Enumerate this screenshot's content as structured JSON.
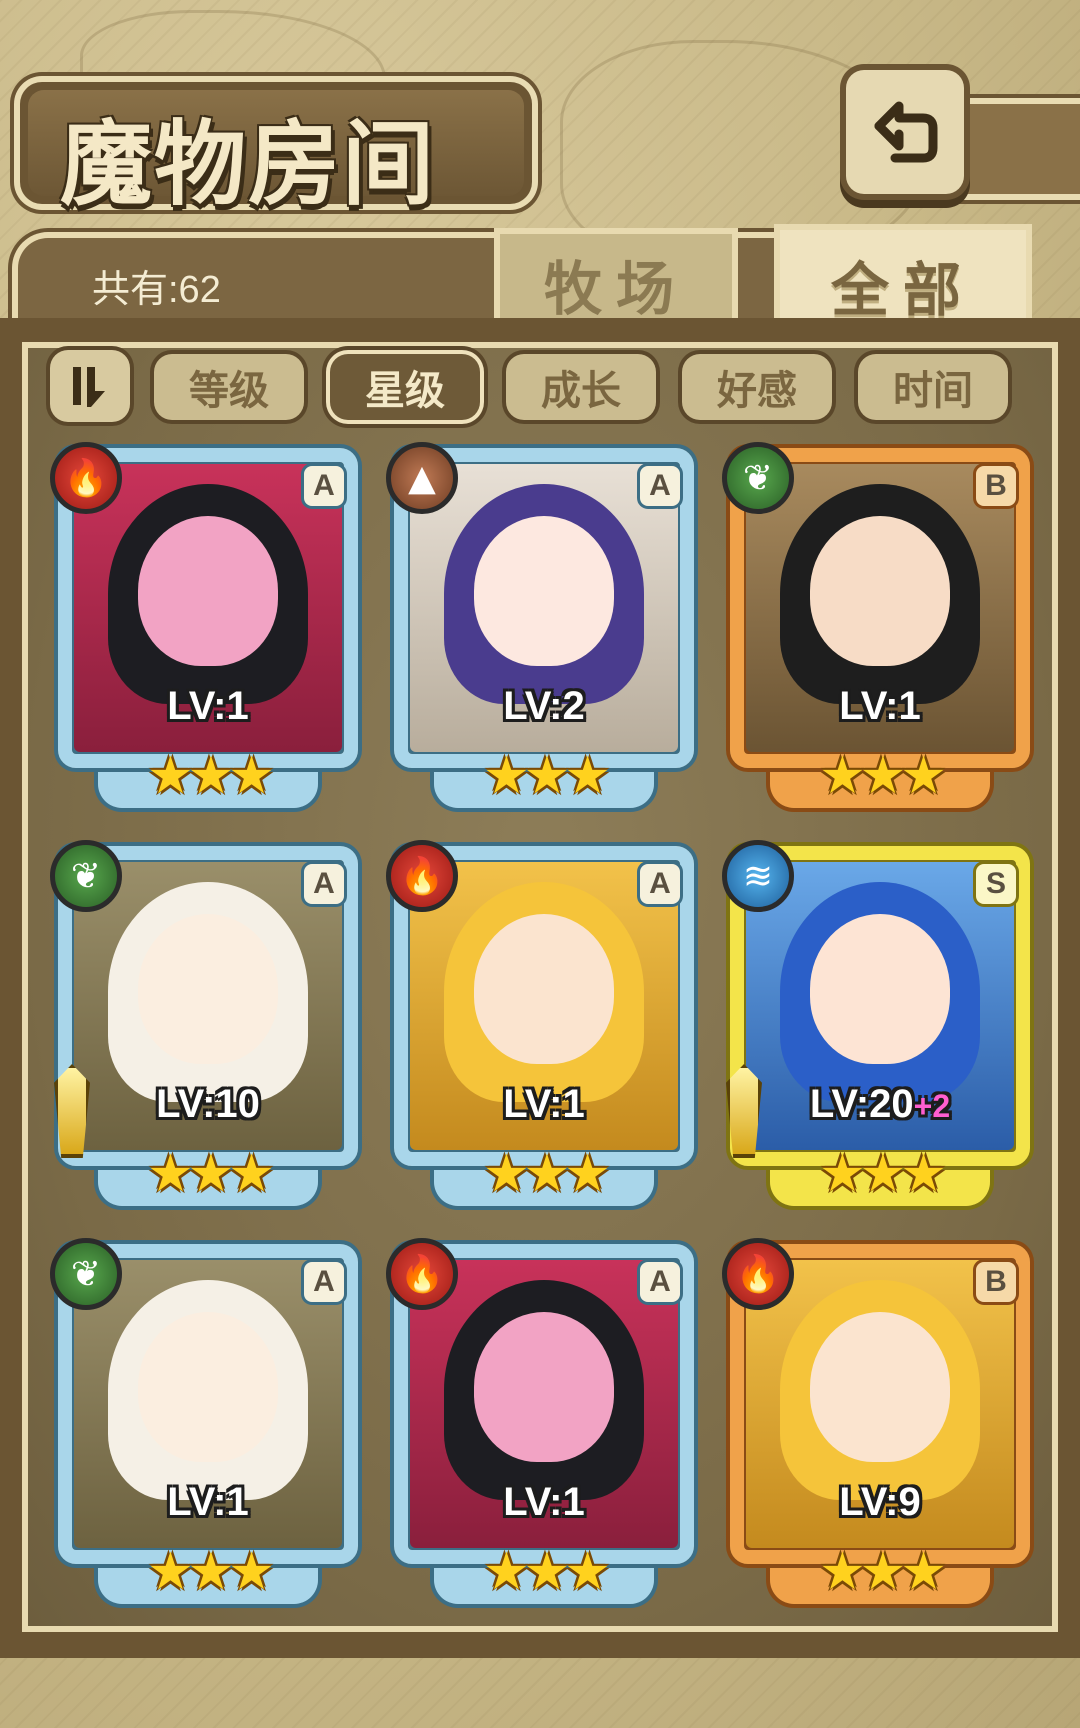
{
  "header": {
    "title": "魔物房间",
    "back_label": "返回"
  },
  "summary": {
    "count_label": "共有:62"
  },
  "tabs": [
    {
      "label": "牧场",
      "active": false
    },
    {
      "label": "全部",
      "active": true
    }
  ],
  "sort": {
    "options": [
      {
        "label": "等级",
        "active": false
      },
      {
        "label": "星级",
        "active": true
      },
      {
        "label": "成长",
        "active": false
      },
      {
        "label": "好感",
        "active": false
      },
      {
        "label": "时间",
        "active": false
      }
    ]
  },
  "monsters": [
    {
      "rank": "A",
      "element": "fire",
      "level": "LV:1",
      "stars": "★★★",
      "frame": "blue",
      "weapon": false
    },
    {
      "rank": "A",
      "element": "earth",
      "level": "LV:2",
      "stars": "★★★",
      "frame": "blue",
      "weapon": false
    },
    {
      "rank": "B",
      "element": "wood",
      "level": "LV:1",
      "stars": "★★★",
      "frame": "gold",
      "weapon": false
    },
    {
      "rank": "A",
      "element": "wood",
      "level": "LV:10",
      "stars": "★★★",
      "frame": "blue",
      "weapon": true
    },
    {
      "rank": "A",
      "element": "fire",
      "level": "LV:1",
      "stars": "★★★",
      "frame": "blue",
      "weapon": false
    },
    {
      "rank": "S",
      "element": "water",
      "level": "LV:20",
      "level_bonus": "+2",
      "stars": "★★★",
      "frame": "yellow",
      "weapon": true
    },
    {
      "rank": "A",
      "element": "wood",
      "level": "LV:1",
      "stars": "★★★",
      "frame": "blue",
      "weapon": false
    },
    {
      "rank": "A",
      "element": "fire",
      "level": "LV:1",
      "stars": "★★★",
      "frame": "blue",
      "weapon": false
    },
    {
      "rank": "B",
      "element": "fire",
      "level": "LV:9",
      "stars": "★★★",
      "frame": "gold",
      "weapon": false
    }
  ],
  "colors": {
    "accent_blue": "#a9d6ea",
    "accent_gold": "#f0a24a",
    "accent_yellow": "#f3e44a",
    "panel": "#7a6a47",
    "star": "#ffd21e"
  },
  "icons": {
    "fire": "fire-icon",
    "earth": "earth-icon",
    "wood": "leaf-icon",
    "water": "water-icon"
  }
}
